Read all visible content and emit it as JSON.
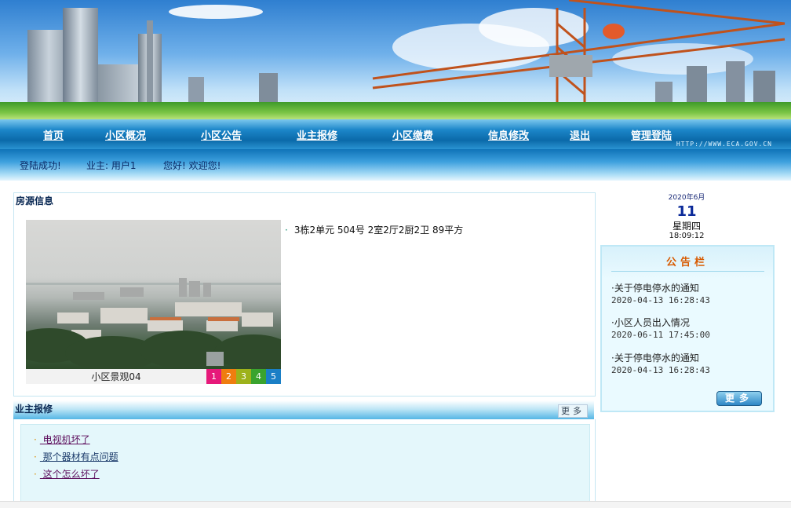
{
  "banner": {
    "site_url": "HTTP://WWW.ECA.GOV.CN"
  },
  "nav": {
    "items": [
      "首页",
      "小区概况",
      "小区公告",
      "业主报修",
      "小区缴费",
      "信息修改",
      "退出",
      "管理登陆"
    ]
  },
  "status": {
    "login_msg": "登陆成功!",
    "owner": "业主: 用户1",
    "greeting": "您好! 欢迎您!"
  },
  "house": {
    "title": "房源信息",
    "info": "3栋2单元  504号  2室2厅2厨2卫  89平方",
    "slideshow": {
      "caption": "小区景观04",
      "numbers": [
        "1",
        "2",
        "3",
        "4",
        "5"
      ],
      "active": "4",
      "colors": [
        "#e6197a",
        "#ef7d0f",
        "#9db21b",
        "#3aa32e",
        "#1a7fc6"
      ]
    }
  },
  "repair": {
    "title": "业主报修",
    "more": "更多",
    "items": [
      " 电视机坏了",
      " 那个器材有点问题",
      " 这个怎么坏了"
    ]
  },
  "calendar": {
    "year_month": "2020年6月",
    "day": "11",
    "weekday": "星期四",
    "time": "18:09:12"
  },
  "notice_board": {
    "title": "公告栏",
    "more": "更多",
    "items": [
      {
        "title": "·关于停电停水的通知",
        "date": "2020-04-13 16:28:43"
      },
      {
        "title": "·小区人员出入情况",
        "date": "2020-06-11 17:45:00"
      },
      {
        "title": "·关于停电停水的通知",
        "date": "2020-04-13 16:28:43"
      }
    ]
  }
}
